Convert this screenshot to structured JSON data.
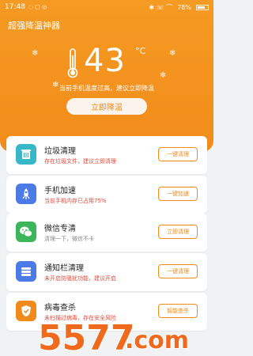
{
  "status": {
    "time": "17:48",
    "left_icons": "◌ ▢ ◎",
    "right_icons": "✱ ☏ ⌒",
    "battery": "78%"
  },
  "app": {
    "title": "超强降温神器"
  },
  "temperature": {
    "value": "43",
    "unit": "°C",
    "hint": "当前手机温度过高，建议立即降温",
    "button": "立即降温"
  },
  "items": [
    {
      "title": "垃圾清理",
      "subtitle": "存在垃圾文件，建议立即清理",
      "subtitle_color": "#e04a3a",
      "button": "一键清理",
      "icon_color": "#37b8c9",
      "icon": "trash-icon"
    },
    {
      "title": "手机加速",
      "subtitle": "当前手机内存已占用75%",
      "subtitle_color": "#e04a3a",
      "button": "一键加速",
      "icon_color": "#4c7be8",
      "icon": "rocket-icon"
    },
    {
      "title": "微信专清",
      "subtitle": "清理一下，微信不卡",
      "subtitle_color": "#888888",
      "button": "立即清理",
      "icon_color": "#3db55a",
      "icon": "wechat-icon"
    },
    {
      "title": "通知栏清理",
      "subtitle": "未开启防骚扰功能，建议开启",
      "subtitle_color": "#e04a3a",
      "button": "一键清理",
      "icon_color": "#4c7be8",
      "icon": "notification-icon"
    },
    {
      "title": "病毒查杀",
      "subtitle": "未扫描过病毒，存在安全风险",
      "subtitle_color": "#e04a3a",
      "button": "智能查杀",
      "icon_color": "#f08a1a",
      "icon": "shield-icon"
    }
  ],
  "watermark": "5577.com"
}
